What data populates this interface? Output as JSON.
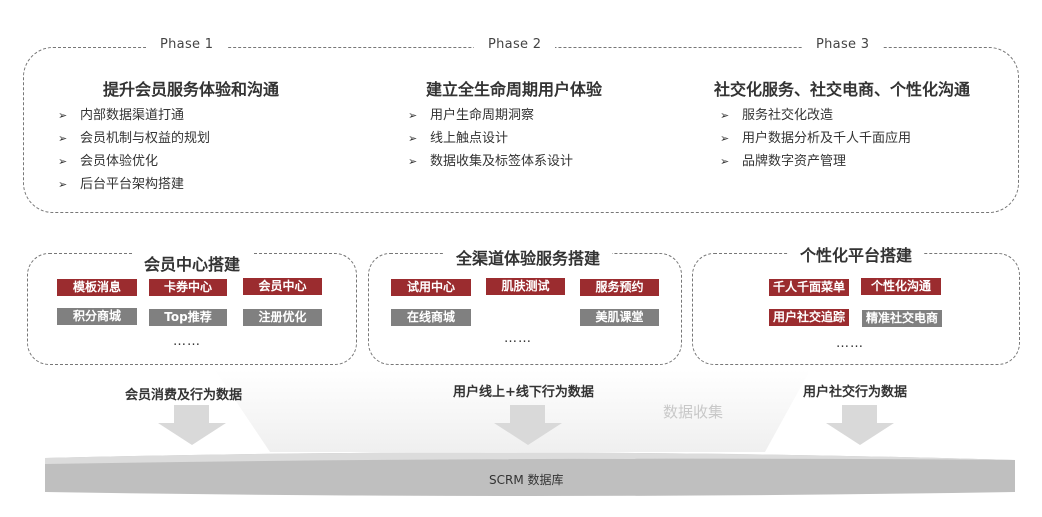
{
  "phases": [
    {
      "label": "Phase 1",
      "title": "提升会员服务体验和沟通",
      "items": [
        "内部数据渠道打通",
        "会员机制与权益的规划",
        "会员体验优化",
        "后台平台架构搭建"
      ]
    },
    {
      "label": "Phase 2",
      "title": "建立全生命周期用户体验",
      "items": [
        "用户生命周期洞察",
        "线上触点设计",
        "数据收集及标签体系设计"
      ]
    },
    {
      "label": "Phase 3",
      "title": "社交化服务、社交电商、个性化沟通",
      "items": [
        "服务社交化改造",
        "用户数据分析及千人千面应用",
        "品牌数字资产管理"
      ]
    }
  ],
  "bullet_glyph": "➢",
  "platforms": [
    {
      "title": "会员中心搭建",
      "tags": [
        {
          "label": "模板消息",
          "color": "red"
        },
        {
          "label": "卡券中心",
          "color": "red"
        },
        {
          "label": "会员中心",
          "color": "red"
        },
        {
          "label": "积分商城",
          "color": "gray"
        },
        {
          "label": "Top推荐",
          "color": "gray"
        },
        {
          "label": "注册优化",
          "color": "gray"
        }
      ],
      "more": "……"
    },
    {
      "title": "全渠道体验服务搭建",
      "tags": [
        {
          "label": "试用中心",
          "color": "red"
        },
        {
          "label": "肌肤测试",
          "color": "red"
        },
        {
          "label": "服务预约",
          "color": "red"
        },
        {
          "label": "在线商城",
          "color": "gray"
        },
        {
          "label": "美肌课堂",
          "color": "gray"
        }
      ],
      "more": "……"
    },
    {
      "title": "个性化平台搭建",
      "tags": [
        {
          "label": "千人千面菜单",
          "color": "red"
        },
        {
          "label": "个性化沟通",
          "color": "red"
        },
        {
          "label": "用户社交追踪",
          "color": "red"
        },
        {
          "label": "精准社交电商",
          "color": "gray"
        }
      ],
      "more": "……"
    }
  ],
  "flows": [
    {
      "label": "会员消费及行为数据"
    },
    {
      "label": "用户线上+线下行为数据"
    },
    {
      "label": "用户社交行为数据"
    }
  ],
  "collect_label": "数据收集",
  "database_label": "SCRM 数据库",
  "colors": {
    "tag_red": "#9b2c2f",
    "tag_gray": "#808080",
    "arrow": "#d9d9d9",
    "database": "#bfbfbf",
    "frame": "#777777"
  }
}
